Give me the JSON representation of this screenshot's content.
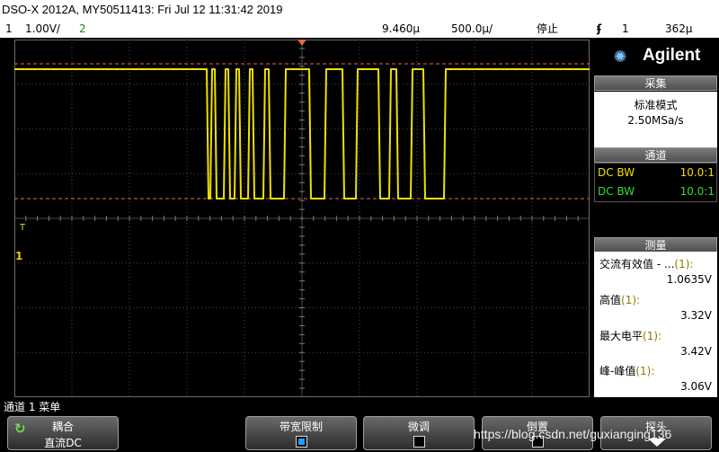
{
  "window": {
    "title": "DSO-X 2012A, MY50511413: Fri Jul 12 11:31:42 2019"
  },
  "status": {
    "ch1_number": "1",
    "ch1_scale": "1.00V/",
    "ch2_number": "2",
    "time_delay": "9.460µ",
    "time_scale": "500.0µ/",
    "run_state": "停止",
    "trigger_icon": "ʄ",
    "trigger_source": "1",
    "trigger_level": "362µ"
  },
  "brand": {
    "name": "Agilent",
    "icon": "spark-burst-icon"
  },
  "acquisition": {
    "header": "采集",
    "mode": "标准模式",
    "rate": "2.50MSa/s"
  },
  "channels": {
    "header": "通道",
    "rows": [
      {
        "coupling": "DC BW",
        "ratio": "10.0:1",
        "color": "#f0e000"
      },
      {
        "coupling": "DC BW",
        "ratio": "10.0:1",
        "color": "#33dd33"
      }
    ]
  },
  "measurements": {
    "header": "测量",
    "items": [
      {
        "label": "交流有效值 - ...",
        "channel": "(1):",
        "value": "1.0635V"
      },
      {
        "label": "高值",
        "channel": "(1):",
        "value": "3.32V"
      },
      {
        "label": "最大电平",
        "channel": "(1):",
        "value": "3.42V"
      },
      {
        "label": "峰-峰值",
        "channel": "(1):",
        "value": "3.06V"
      }
    ]
  },
  "screen_markers": {
    "trigger_level_marker": "T",
    "ch1_ground_marker": "1"
  },
  "menu": {
    "title": "通道 1 菜单",
    "softkeys": [
      {
        "label": "耦合",
        "value": "直流DC"
      },
      {
        "label": "带宽限制",
        "checked": true
      },
      {
        "label": "微调",
        "checked": false
      },
      {
        "label": "倒置",
        "checked": false
      },
      {
        "label": "探头"
      }
    ]
  },
  "watermark": "https://blog.csdn.net/guxianging136",
  "colors": {
    "ch1": "#f0e000",
    "ch2": "#33dd33",
    "accent": "#2a9cff"
  }
}
